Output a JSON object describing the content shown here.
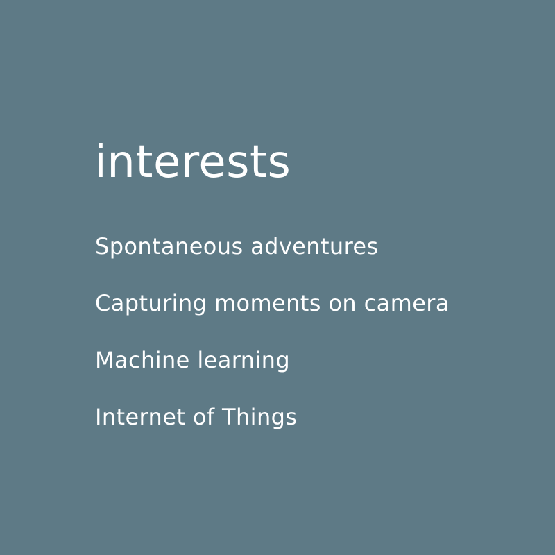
{
  "colors": {
    "background": "#5e7a86",
    "text": "#ffffff"
  },
  "heading": "interests",
  "interests": [
    "Spontaneous adventures",
    "Capturing moments on camera",
    "Machine learning",
    "Internet of Things"
  ]
}
